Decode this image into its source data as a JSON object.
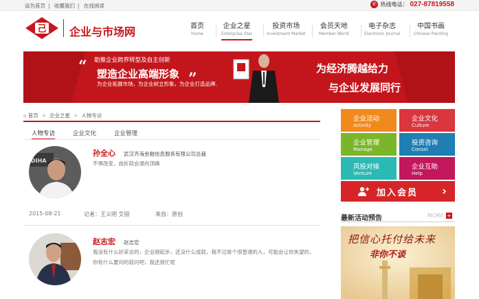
{
  "topbar": {
    "links": [
      "设为首页",
      "收藏我们",
      "在线阅读"
    ],
    "hotline_label": "热线电话：",
    "hotline_number": "027-87819558"
  },
  "header": {
    "logo_text": "企业与市场网"
  },
  "nav": [
    {
      "cn": "首页",
      "en": "Home"
    },
    {
      "cn": "企业之星",
      "en": "Enterprise Star"
    },
    {
      "cn": "投资市场",
      "en": "Investment Market"
    },
    {
      "cn": "会员天地",
      "en": "Member World"
    },
    {
      "cn": "电子杂志",
      "en": "Electronic Journal"
    },
    {
      "cn": "中国书画",
      "en": "Chinese Painting"
    }
  ],
  "banner": {
    "line1": "助推企业跨界转型及自主创新",
    "line2": "塑造企业高端形象",
    "line3": "为企业拓展市场，为企业树立形象，为企业打造品牌.",
    "right1": "为经济腾越给力",
    "right2": "与企业发展同行"
  },
  "breadcrumb": [
    "首页",
    "企业之星",
    "人物专访"
  ],
  "subtabs": [
    "人物专访",
    "企业文化",
    "企业管理"
  ],
  "articles": [
    {
      "name": "孙全心",
      "title": "武汉齐海金融信息服务有限公司总裁",
      "desc": "不惧改变，由折就会通向顶峰",
      "date": "2015-08-21",
      "reporter": "记者：王义明 艾丽",
      "source": "来自：原创"
    },
    {
      "name": "赵志宏",
      "title": "赵志宏",
      "desc": "我没有什么好采访的，企业刚起步，还没什么成就，我不过是个很普通的人，可能会让你失望的，你有什么要问的就问吧，我还很忙呢"
    }
  ],
  "sidebar": {
    "tiles": [
      {
        "cn": "企业活动",
        "en": "Activity",
        "color": "#f08a1c"
      },
      {
        "cn": "企业文化",
        "en": "Culture",
        "color": "#d9363e"
      },
      {
        "cn": "企业管理",
        "en": "Manage",
        "color": "#7bb52a"
      },
      {
        "cn": "投资咨询",
        "en": "Consel",
        "color": "#1f7fb5"
      },
      {
        "cn": "风投对接",
        "en": "Venture",
        "color": "#2bb9b4"
      },
      {
        "cn": "企业互助",
        "en": "Help",
        "color": "#c2185b"
      }
    ],
    "join_label": "加入会员",
    "activity_title": "最新活动预告",
    "more_label": "MORE",
    "poster_line1": "把信心托付给未来",
    "poster_line2": "非你不谈"
  }
}
